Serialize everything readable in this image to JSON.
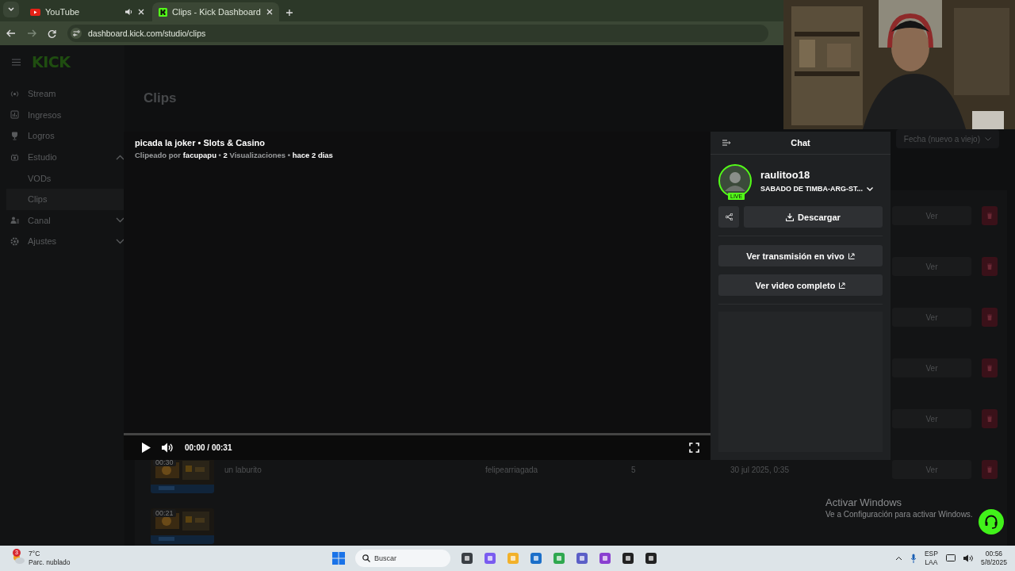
{
  "browser": {
    "tabs": [
      {
        "title": "YouTube",
        "selected": false,
        "audio": true
      },
      {
        "title": "Clips - Kick Dashboard",
        "selected": true,
        "audio": false
      }
    ],
    "url": "dashboard.kick.com/studio/clips"
  },
  "sidebar": {
    "logo": "KICK",
    "items": [
      {
        "label": "Stream",
        "selected": false
      },
      {
        "label": "Ingresos",
        "selected": false
      },
      {
        "label": "Logros",
        "selected": false
      },
      {
        "label": "Estudio",
        "selected": false,
        "expanded": true,
        "children": [
          {
            "label": "VODs",
            "selected": false
          },
          {
            "label": "Clips",
            "selected": true
          }
        ]
      },
      {
        "label": "Canal",
        "selected": false,
        "expanded": false
      },
      {
        "label": "Ajustes",
        "selected": false,
        "expanded": false
      }
    ]
  },
  "main": {
    "title": "Clips",
    "sort": "Fecha (nuevo a viejo)",
    "rows": [
      {
        "action": "Ver"
      },
      {
        "action": "Ver"
      },
      {
        "action": "Ver"
      },
      {
        "action": "Ver"
      },
      {
        "action": "Ver"
      },
      {
        "duration": "00:30",
        "title": "un laburito",
        "clipper": "felipearriagada",
        "views": "5",
        "date": "30 jul 2025, 0:35",
        "action": "Ver"
      },
      {
        "duration": "00:21"
      }
    ]
  },
  "clip_modal": {
    "title": "picada la joker • Slots & Casino",
    "meta": "Clipeado por **facupapu** • **2** Visualizaciones • **hace 2 dias**",
    "player": {
      "playing": false,
      "muted": false,
      "progress": {
        "level": 0
      },
      "time": "00:00 / 00:31"
    },
    "chat": {
      "header": "Chat",
      "channel": "raulitoo18",
      "live_badge": "LIVE",
      "stream_title": "SABADO DE TIMBA-ARG-ST...",
      "download": "Descargar",
      "links": [
        "Ver transmisión en vivo",
        "Ver video completo"
      ]
    }
  },
  "windows_notice": {
    "title": "Activar Windows",
    "text": "Ve a Configuración para activar Windows."
  },
  "taskbar": {
    "weather": {
      "badge": "3",
      "temp": "7°C",
      "condition": "Parc. nublado"
    },
    "search": {
      "placeholder": "Buscar"
    },
    "tray": {
      "language": "ESP",
      "layout": "LAA",
      "time": "00:56",
      "date": "5/8/2025"
    }
  }
}
